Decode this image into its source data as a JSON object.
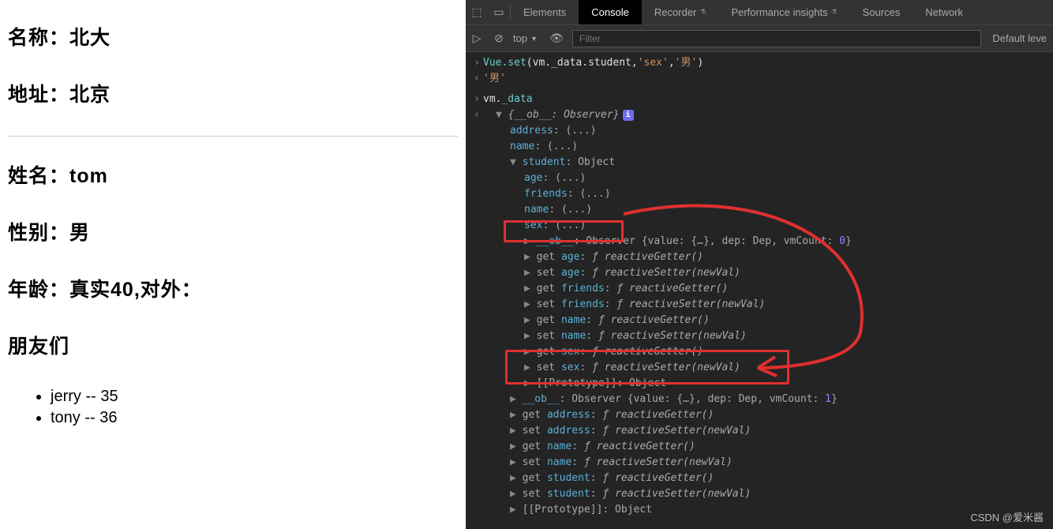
{
  "page": {
    "school_label": "名称：",
    "school_value": "北大",
    "address_label": "地址：",
    "address_value": "北京",
    "name_label": "姓名：",
    "name_value": "tom",
    "sex_label": "性别：",
    "sex_value": "男",
    "age_label": "年龄：",
    "age_value": "真实40,对外：",
    "friends_title": "朋友们",
    "friend1": "jerry -- 35",
    "friend2": "tony -- 36"
  },
  "tabs": {
    "elements": "Elements",
    "console": "Console",
    "recorder": "Recorder",
    "perf": "Performance insights",
    "sources": "Sources",
    "network": "Network"
  },
  "toolbar": {
    "context": "top",
    "filter_ph": "Filter",
    "level": "Default leve"
  },
  "console": {
    "cmd1_pre": "Vue",
    "cmd1_set": ".set",
    "cmd1_args": "(vm._data.student,",
    "cmd1_s1": "'sex'",
    "cmd1_c": ",",
    "cmd1_s2": "'男'",
    "cmd1_end": ")",
    "ret1": "'男'",
    "cmd2": "vm.",
    "cmd2b": "_data",
    "obj_head": "{__ob__: Observer}",
    "p_address": "address",
    "p_name": "name",
    "p_student": "student",
    "p_student_v": ": Object",
    "p_age": "age",
    "p_friends": "friends",
    "p_sex": "sex",
    "ellipsis": ": (...)",
    "ob": "__ob__",
    "ob_v1": ": Observer {value: {…}, dep: Dep, vmCount: ",
    "ob_n0": "0",
    "ob_n1": "1",
    "ob_end": "}",
    "get": "get ",
    "set": "set ",
    "rg": "reactiveGetter()",
    "rs": "reactiveSetter(newVal)",
    "f": "ƒ ",
    "colon": ": ",
    "proto": "[[Prototype]]",
    "proto_v": ": Object"
  },
  "watermark": "CSDN @爱米酱"
}
